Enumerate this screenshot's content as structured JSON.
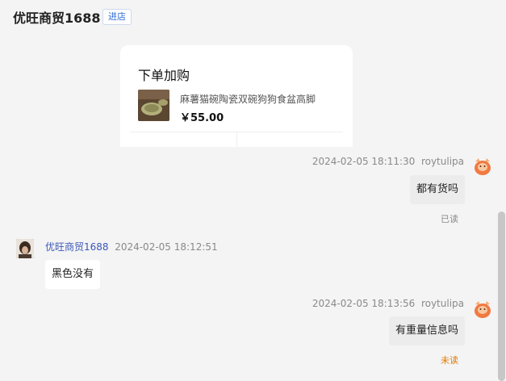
{
  "header": {
    "shop_name": "优旺商贸1688",
    "enter_label": "进店"
  },
  "order_card": {
    "title": "下单加购",
    "product_name": "麻薯猫碗陶瓷双碗狗狗食盆高脚",
    "price": "￥55.00",
    "image_icon": "product-photo"
  },
  "messages": [
    {
      "sender": "roytulipa",
      "time": "2024-02-05 18:11:30",
      "text": "都有货吗",
      "status": "已读",
      "side": "right"
    },
    {
      "sender": "优旺商贸1688",
      "time": "2024-02-05 18:12:51",
      "text": "黑色没有",
      "side": "left"
    },
    {
      "sender": "roytulipa",
      "time": "2024-02-05 18:13:56",
      "text": "有重量信息吗",
      "status": "未读",
      "side": "right"
    }
  ],
  "colors": {
    "read": "#8a8a8a",
    "unread": "#e07b00",
    "sender_link": "#3b58b8",
    "avatar_orange": "#f07a42"
  }
}
